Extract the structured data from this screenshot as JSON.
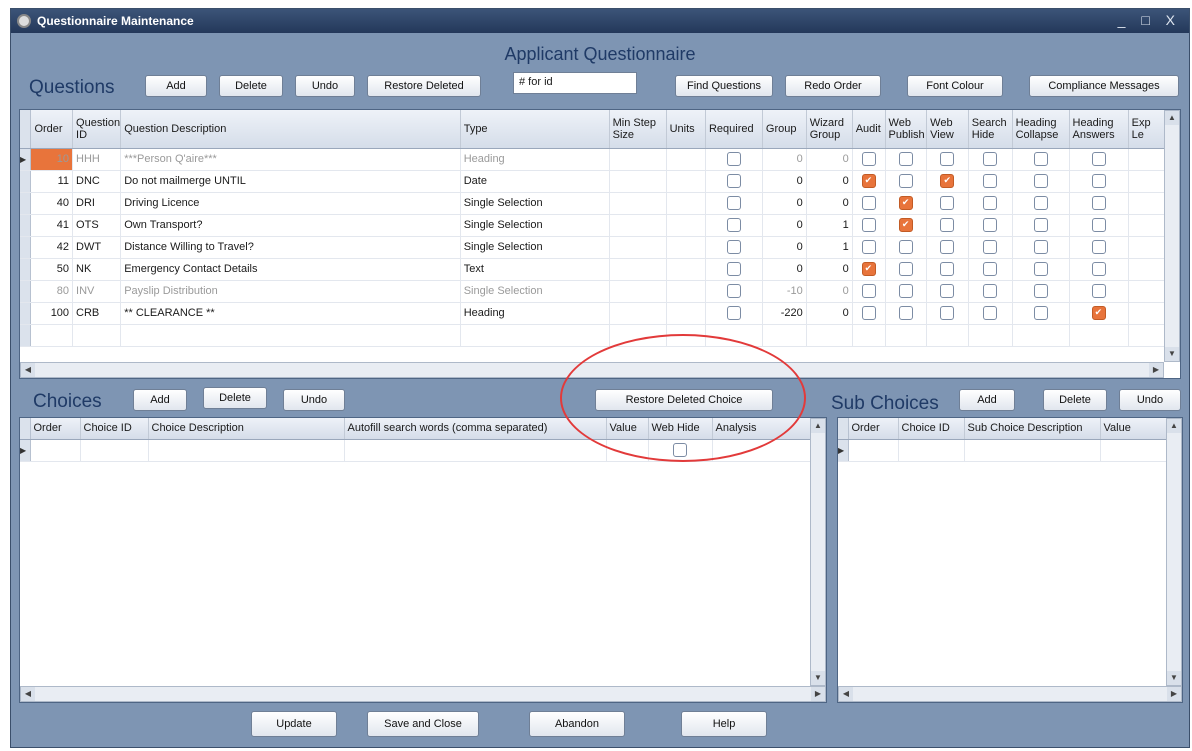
{
  "window": {
    "title": "Questionnaire Maintenance",
    "controls": "_ □ X"
  },
  "form_heading": "Applicant Questionnaire",
  "questions": {
    "title": "Questions",
    "buttons": {
      "add": "Add",
      "delete": "Delete",
      "undo": "Undo",
      "restore_deleted": "Restore Deleted",
      "find_questions": "Find Questions",
      "redo_order": "Redo Order",
      "font_colour": "Font Colour",
      "compliance_messages": "Compliance Messages"
    },
    "search_value": "# for id",
    "columns": [
      "Order",
      "Question ID",
      "Question Description",
      "Type",
      "Min Step Size",
      "Units",
      "Required",
      "Group",
      "Wizard Group",
      "Audit",
      "Web Publish",
      "Web View",
      "Search Hide",
      "Heading Collapse",
      "Heading Answers",
      "Exp Le"
    ],
    "rows": [
      {
        "order": "10",
        "id": "HHH",
        "description": "***Person Q'aire***",
        "type": "Heading",
        "group": "0",
        "wizard_group": "0",
        "audit": false,
        "web_publish": false,
        "web_view": false,
        "heading_answers": false,
        "dim": true
      },
      {
        "order": "11",
        "id": "DNC",
        "description": "Do not mailmerge UNTIL",
        "type": "Date",
        "group": "0",
        "wizard_group": "0",
        "audit": true,
        "web_publish": false,
        "web_view": true,
        "heading_answers": false,
        "dim": false
      },
      {
        "order": "40",
        "id": "DRI",
        "description": "Driving Licence",
        "type": "Single Selection",
        "group": "0",
        "wizard_group": "0",
        "audit": false,
        "web_publish": true,
        "web_view": false,
        "heading_answers": false,
        "dim": false
      },
      {
        "order": "41",
        "id": "OTS",
        "description": "Own Transport?",
        "type": "Single Selection",
        "group": "0",
        "wizard_group": "1",
        "audit": false,
        "web_publish": true,
        "web_view": false,
        "heading_answers": false,
        "dim": false
      },
      {
        "order": "42",
        "id": "DWT",
        "description": "Distance Willing to Travel?",
        "type": "Single Selection",
        "group": "0",
        "wizard_group": "1",
        "audit": false,
        "web_publish": false,
        "web_view": false,
        "heading_answers": false,
        "dim": false
      },
      {
        "order": "50",
        "id": "NK",
        "description": "Emergency Contact Details",
        "type": "Text",
        "group": "0",
        "wizard_group": "0",
        "audit": true,
        "web_publish": false,
        "web_view": false,
        "heading_answers": false,
        "dim": false
      },
      {
        "order": "80",
        "id": "INV",
        "description": "Payslip Distribution",
        "type": "Single Selection",
        "group": "-10",
        "wizard_group": "0",
        "audit": false,
        "web_publish": false,
        "web_view": false,
        "heading_answers": false,
        "dim": true
      },
      {
        "order": "100",
        "id": "CRB",
        "description": "** CLEARANCE **",
        "type": "Heading",
        "group": "-220",
        "wizard_group": "0",
        "audit": false,
        "web_publish": false,
        "web_view": false,
        "heading_answers": true,
        "dim": false
      }
    ]
  },
  "choices": {
    "title": "Choices",
    "buttons": {
      "add": "Add",
      "delete": "Delete",
      "undo": "Undo",
      "restore_deleted_choice": "Restore Deleted Choice"
    },
    "columns": [
      "Order",
      "Choice ID",
      "Choice Description",
      "Autofill search words (comma separated)",
      "Value",
      "Web Hide",
      "Analysis"
    ]
  },
  "sub_choices": {
    "title": "Sub Choices",
    "buttons": {
      "add": "Add",
      "delete": "Delete",
      "undo": "Undo"
    },
    "columns": [
      "Order",
      "Choice ID",
      "Sub Choice Description",
      "Value"
    ]
  },
  "footer": {
    "update": "Update",
    "save_and_close": "Save and Close",
    "abandon": "Abandon",
    "help": "Help"
  },
  "colors": {
    "window_bg": "#7e95b3",
    "heading_text": "#1f3a66",
    "checked": "#e8743b",
    "annotation_circle": "#e23a3a"
  }
}
